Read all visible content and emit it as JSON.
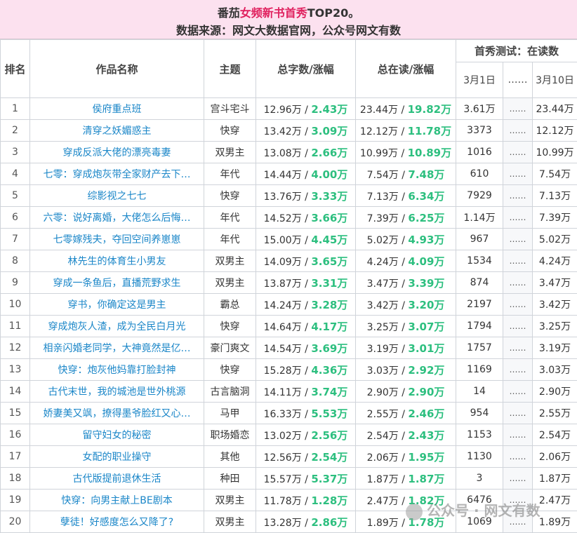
{
  "header": {
    "line1_pre": "番茄",
    "line1_highlight": "女频新书首秀",
    "line1_post": "TOP20。",
    "line2": "数据来源：网文大数据官网，公众号网文有数"
  },
  "columns": {
    "rank": "排名",
    "name": "作品名称",
    "theme": "主题",
    "words": "总字数/涨幅",
    "readers": "总在读/涨幅",
    "test_group": "首秀测试：在读数",
    "day1": "3月1日",
    "mid": "……",
    "day10": "3月10日"
  },
  "rows": [
    {
      "rank": "1",
      "name": "侯府重点班",
      "theme": "宫斗宅斗",
      "words": "12.96万",
      "wg": "2.43万",
      "readers": "23.44万",
      "rg": "19.82万",
      "d1": "3.61万",
      "mid": "……",
      "d10": "23.44万"
    },
    {
      "rank": "2",
      "name": "清穿之妖媚惑主",
      "theme": "快穿",
      "words": "13.42万",
      "wg": "3.09万",
      "readers": "12.12万",
      "rg": "11.78万",
      "d1": "3373",
      "mid": "……",
      "d10": "12.12万"
    },
    {
      "rank": "3",
      "name": "穿成反派大佬的漂亮毒妻",
      "theme": "双男主",
      "words": "13.08万",
      "wg": "2.66万",
      "readers": "10.99万",
      "rg": "10.89万",
      "d1": "1016",
      "mid": "……",
      "d10": "10.99万"
    },
    {
      "rank": "4",
      "name": "七零：穿成炮灰带全家财产去下…",
      "theme": "年代",
      "words": "14.44万",
      "wg": "4.00万",
      "readers": "7.54万",
      "rg": "7.48万",
      "d1": "610",
      "mid": "……",
      "d10": "7.54万"
    },
    {
      "rank": "5",
      "name": "综影视之七七",
      "theme": "快穿",
      "words": "13.76万",
      "wg": "3.33万",
      "readers": "7.13万",
      "rg": "6.34万",
      "d1": "7929",
      "mid": "……",
      "d10": "7.13万"
    },
    {
      "rank": "6",
      "name": "六零：说好离婚，大佬怎么后悔…",
      "theme": "年代",
      "words": "14.52万",
      "wg": "3.66万",
      "readers": "7.39万",
      "rg": "6.25万",
      "d1": "1.14万",
      "mid": "……",
      "d10": "7.39万"
    },
    {
      "rank": "7",
      "name": "七零嫁残夫，夺回空间养崽崽",
      "theme": "年代",
      "words": "15.00万",
      "wg": "4.45万",
      "readers": "5.02万",
      "rg": "4.93万",
      "d1": "967",
      "mid": "……",
      "d10": "5.02万"
    },
    {
      "rank": "8",
      "name": "林先生的体育生小男友",
      "theme": "双男主",
      "words": "14.09万",
      "wg": "3.65万",
      "readers": "4.24万",
      "rg": "4.09万",
      "d1": "1534",
      "mid": "……",
      "d10": "4.24万"
    },
    {
      "rank": "9",
      "name": "穿成一条鱼后，直播荒野求生",
      "theme": "双男主",
      "words": "13.87万",
      "wg": "3.31万",
      "readers": "3.47万",
      "rg": "3.39万",
      "d1": "874",
      "mid": "……",
      "d10": "3.47万"
    },
    {
      "rank": "10",
      "name": "穿书，你确定这是男主",
      "theme": "霸总",
      "words": "14.24万",
      "wg": "3.28万",
      "readers": "3.42万",
      "rg": "3.20万",
      "d1": "2197",
      "mid": "……",
      "d10": "3.42万"
    },
    {
      "rank": "11",
      "name": "穿成炮灰人渣，成为全民白月光",
      "theme": "快穿",
      "words": "14.64万",
      "wg": "4.17万",
      "readers": "3.25万",
      "rg": "3.07万",
      "d1": "1794",
      "mid": "……",
      "d10": "3.25万"
    },
    {
      "rank": "12",
      "name": "相亲闪婚老同学，大神竟然是亿…",
      "theme": "豪门爽文",
      "words": "14.54万",
      "wg": "3.69万",
      "readers": "3.19万",
      "rg": "3.01万",
      "d1": "1757",
      "mid": "……",
      "d10": "3.19万"
    },
    {
      "rank": "13",
      "name": "快穿：炮灰他妈靠打脸封神",
      "theme": "快穿",
      "words": "15.28万",
      "wg": "4.36万",
      "readers": "3.03万",
      "rg": "2.92万",
      "d1": "1169",
      "mid": "……",
      "d10": "3.03万"
    },
    {
      "rank": "14",
      "name": "古代末世，我的城池是世外桃源",
      "theme": "古言脑洞",
      "words": "14.11万",
      "wg": "3.74万",
      "readers": "2.90万",
      "rg": "2.90万",
      "d1": "14",
      "mid": "……",
      "d10": "2.90万"
    },
    {
      "rank": "15",
      "name": "娇妻美又飒，撩得墨爷脸红又心…",
      "theme": "马甲",
      "words": "16.33万",
      "wg": "5.53万",
      "readers": "2.55万",
      "rg": "2.46万",
      "d1": "954",
      "mid": "……",
      "d10": "2.55万"
    },
    {
      "rank": "16",
      "name": "留守妇女的秘密",
      "theme": "职场婚恋",
      "words": "13.02万",
      "wg": "2.56万",
      "readers": "2.54万",
      "rg": "2.43万",
      "d1": "1153",
      "mid": "……",
      "d10": "2.54万"
    },
    {
      "rank": "17",
      "name": "女配的职业操守",
      "theme": "其他",
      "words": "12.56万",
      "wg": "2.54万",
      "readers": "2.06万",
      "rg": "1.95万",
      "d1": "1130",
      "mid": "……",
      "d10": "2.06万"
    },
    {
      "rank": "18",
      "name": "古代版提前退休生活",
      "theme": "种田",
      "words": "15.57万",
      "wg": "5.37万",
      "readers": "1.87万",
      "rg": "1.87万",
      "d1": "3",
      "mid": "……",
      "d10": "1.87万"
    },
    {
      "rank": "19",
      "name": "快穿：向男主献上BE剧本",
      "theme": "双男主",
      "words": "11.78万",
      "wg": "1.28万",
      "readers": "2.47万",
      "rg": "1.82万",
      "d1": "6476",
      "mid": "……",
      "d10": "2.47万"
    },
    {
      "rank": "20",
      "name": "孽徒！好感度怎么又降了?",
      "theme": "双男主",
      "words": "13.28万",
      "wg": "2.86万",
      "readers": "1.89万",
      "rg": "1.78万",
      "d1": "1069",
      "mid": "……",
      "d10": "1.89万"
    }
  ],
  "watermark": "公众号 · 网文有数"
}
